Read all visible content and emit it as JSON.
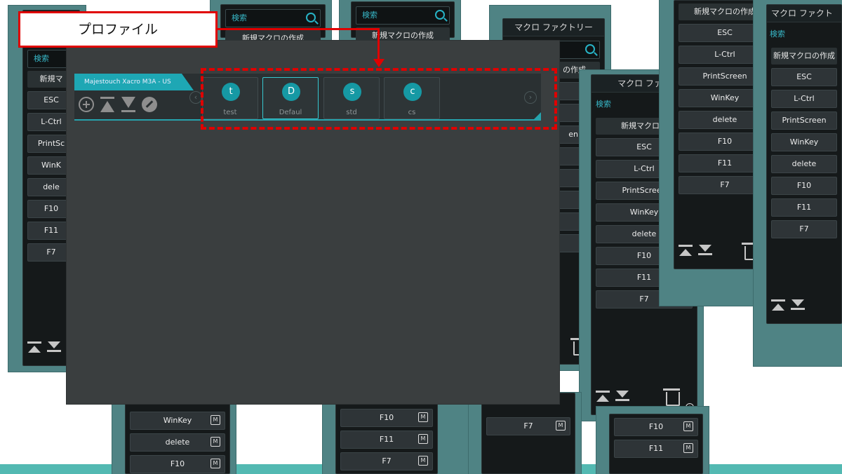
{
  "annotation": {
    "label": "プロファイル"
  },
  "device": {
    "name": "Majestouch Xacro M3A - US"
  },
  "profiles": [
    {
      "initial": "t",
      "name": "test",
      "active": false
    },
    {
      "initial": "D",
      "name": "Defaul",
      "active": true
    },
    {
      "initial": "s",
      "name": "std",
      "active": false
    },
    {
      "initial": "c",
      "name": "cs",
      "active": false
    }
  ],
  "macro_factory": {
    "title": "マクロ ファクトリー",
    "title_truncated": "マクロ ファク",
    "title_truncated_short": "マクロ ファクト",
    "search_placeholder": "検索",
    "new_macro": "新規マクロの作成",
    "new_macro_cut": "新規マ",
    "new_macro_cut2": "新規マクロの",
    "new_macro_cut3": "の作成",
    "new_macro_cut4": "新規マクロの作成",
    "badge": "M",
    "info": "i",
    "items": [
      "ESC",
      "L-Ctrl",
      "PrintScreen",
      "WinKey",
      "delete",
      "F10",
      "F11",
      "F7"
    ],
    "items_cut": [
      "ESC",
      "L-Ctrl",
      "PrintSc",
      "WinK",
      "dele",
      "F10",
      "F11",
      "F7"
    ],
    "cut_text": "en"
  },
  "colors": {
    "accent": "#1ea7b4",
    "annotation": "#e00000",
    "window_frame": "#4f8384"
  },
  "icons": [
    "search-icon",
    "add-icon",
    "upload-icon",
    "download-icon",
    "edit-icon",
    "trash-icon",
    "info-icon",
    "chevron-left-icon",
    "chevron-right-icon"
  ]
}
